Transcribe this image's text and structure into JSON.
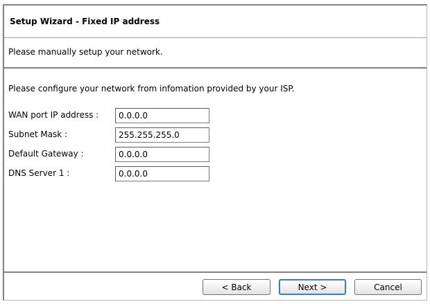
{
  "header": {
    "title": "Setup Wizard - Fixed IP address"
  },
  "subheader": {
    "text": "Please manually setup your network."
  },
  "form": {
    "instruction": "Please configure your network from infomation provided by your ISP.",
    "fields": [
      {
        "label": "WAN port IP address :",
        "value": "0.0.0.0"
      },
      {
        "label": "Subnet Mask :",
        "value": "255.255.255.0"
      },
      {
        "label": "Default Gateway :",
        "value": "0.0.0.0"
      },
      {
        "label": "DNS Server 1 :",
        "value": "0.0.0.0"
      }
    ]
  },
  "footer": {
    "back_label": "< Back",
    "next_label": "Next >",
    "cancel_label": "Cancel"
  }
}
